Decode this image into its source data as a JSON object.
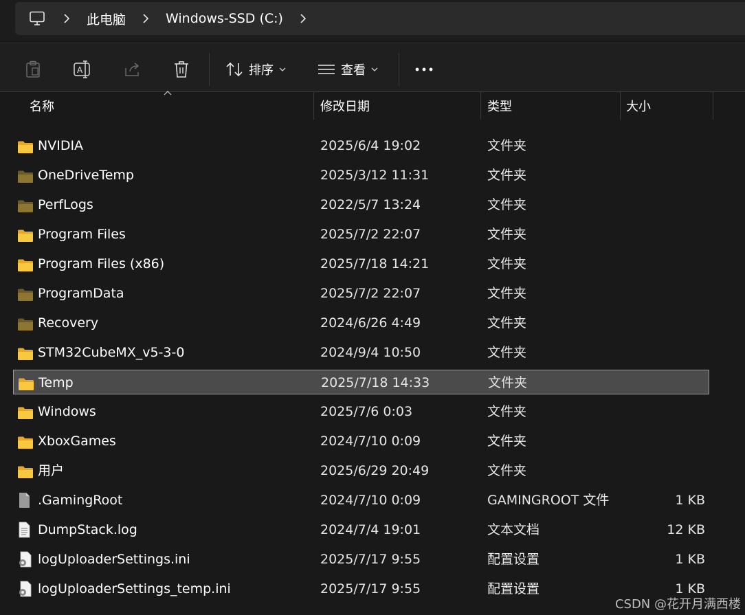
{
  "address": {
    "crumbs": [
      "此电脑",
      "Windows-SSD (C:)"
    ]
  },
  "toolbar": {
    "sort_label": "排序",
    "view_label": "查看"
  },
  "columns": {
    "name": "名称",
    "date": "修改日期",
    "type": "类型",
    "size": "大小"
  },
  "rows": [
    {
      "name": "NVIDIA",
      "date": "2025/6/4 19:02",
      "type": "文件夹",
      "size": "",
      "icon": "folder-icon"
    },
    {
      "name": "OneDriveTemp",
      "date": "2025/3/12 11:31",
      "type": "文件夹",
      "size": "",
      "icon": "folder-dim-icon"
    },
    {
      "name": "PerfLogs",
      "date": "2022/5/7 13:24",
      "type": "文件夹",
      "size": "",
      "icon": "folder-dim-icon"
    },
    {
      "name": "Program Files",
      "date": "2025/7/2 22:07",
      "type": "文件夹",
      "size": "",
      "icon": "folder-icon"
    },
    {
      "name": "Program Files (x86)",
      "date": "2025/7/18 14:21",
      "type": "文件夹",
      "size": "",
      "icon": "folder-icon"
    },
    {
      "name": "ProgramData",
      "date": "2025/7/2 22:07",
      "type": "文件夹",
      "size": "",
      "icon": "folder-dim-icon"
    },
    {
      "name": "Recovery",
      "date": "2024/6/26 4:49",
      "type": "文件夹",
      "size": "",
      "icon": "folder-dim-icon"
    },
    {
      "name": "STM32CubeMX_v5-3-0",
      "date": "2024/9/4 10:50",
      "type": "文件夹",
      "size": "",
      "icon": "folder-icon"
    },
    {
      "name": "Temp",
      "date": "2025/7/18 14:33",
      "type": "文件夹",
      "size": "",
      "icon": "folder-icon",
      "selected": true
    },
    {
      "name": "Windows",
      "date": "2025/7/6 0:03",
      "type": "文件夹",
      "size": "",
      "icon": "folder-icon"
    },
    {
      "name": "XboxGames",
      "date": "2024/7/10 0:09",
      "type": "文件夹",
      "size": "",
      "icon": "folder-icon"
    },
    {
      "name": "用户",
      "date": "2025/6/29 20:49",
      "type": "文件夹",
      "size": "",
      "icon": "folder-icon"
    },
    {
      "name": ".GamingRoot",
      "date": "2024/7/10 0:09",
      "type": "GAMINGROOT 文件",
      "size": "1 KB",
      "icon": "generic-file-icon"
    },
    {
      "name": "DumpStack.log",
      "date": "2024/7/4 19:01",
      "type": "文本文档",
      "size": "12 KB",
      "icon": "text-file-icon"
    },
    {
      "name": "logUploaderSettings.ini",
      "date": "2025/7/17 9:55",
      "type": "配置设置",
      "size": "1 KB",
      "icon": "settings-file-icon"
    },
    {
      "name": "logUploaderSettings_temp.ini",
      "date": "2025/7/17 9:55",
      "type": "配置设置",
      "size": "1 KB",
      "icon": "settings-file-icon"
    }
  ],
  "watermark": "CSDN @花开月满西楼",
  "colors": {
    "folder": "#f8c841",
    "folder_dim": "#8d7532",
    "selection": "#4b4b4b",
    "background": "#191919"
  }
}
